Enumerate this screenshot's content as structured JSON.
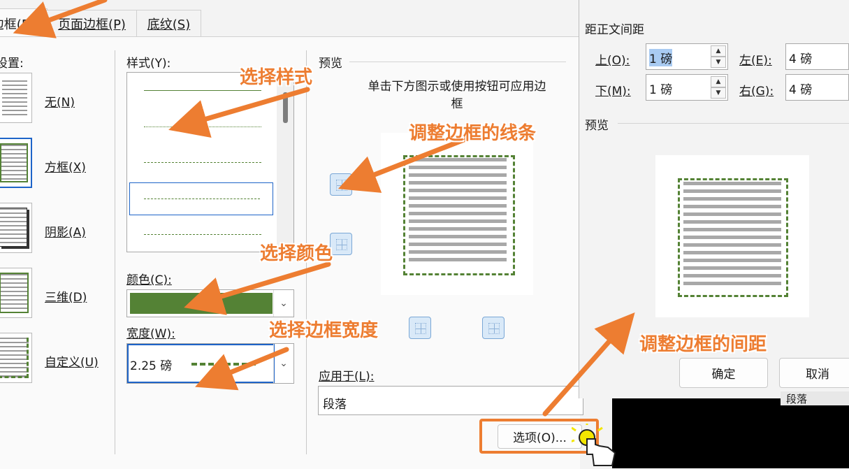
{
  "tabs": [
    {
      "label": "边框(B)"
    },
    {
      "label": "页面边框(P)"
    },
    {
      "label": "底纹(S)"
    }
  ],
  "settings": {
    "title": "设置:",
    "items": [
      {
        "label": "无(N)"
      },
      {
        "label": "方框(X)"
      },
      {
        "label": "阴影(A)"
      },
      {
        "label": "三维(D)"
      },
      {
        "label": "自定义(U)"
      }
    ]
  },
  "style": {
    "label": "样式(Y):"
  },
  "color": {
    "label": "颜色(C):",
    "value": "#548235"
  },
  "width": {
    "label": "宽度(W):",
    "value": "2.25 磅"
  },
  "preview": {
    "title": "预览",
    "hint": "单击下方图示或使用按钮可应用边框"
  },
  "apply": {
    "label": "应用于(L):",
    "value": "段落"
  },
  "options_button": "选项(O)...",
  "options_dialog": {
    "group_title": "距正文间距",
    "top_label": "上(O):",
    "top_value": "1 磅",
    "bottom_label": "下(M):",
    "bottom_value": "1 磅",
    "left_label": "左(E):",
    "left_value": "4 磅",
    "right_label": "右(G):",
    "right_value": "4 磅",
    "preview_title": "预览",
    "ok": "确定",
    "cancel": "取消"
  },
  "background_fragment": "段落",
  "annotations": {
    "select_style": "选择样式",
    "adjust_lines": "调整边框的线条",
    "select_color": "选择颜色",
    "select_width": "选择边框宽度",
    "adjust_spacing": "调整边框的间距"
  },
  "colors": {
    "accent": "#ed7d31",
    "border_green": "#548235",
    "selection_blue": "#1e64c8"
  }
}
